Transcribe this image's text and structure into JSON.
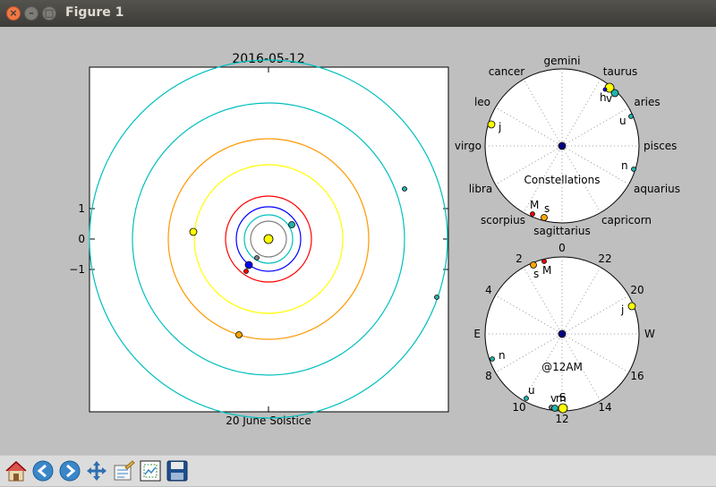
{
  "window": {
    "title": "Figure 1"
  },
  "toolbar": {
    "buttons": [
      {
        "name": "home-button",
        "icon": "home-icon"
      },
      {
        "name": "back-button",
        "icon": "back-arrow-icon"
      },
      {
        "name": "forward-button",
        "icon": "forward-arrow-icon"
      },
      {
        "name": "pan-button",
        "icon": "move-icon"
      },
      {
        "name": "configure-subplots-button",
        "icon": "edit-icon"
      },
      {
        "name": "zoom-to-rect-button",
        "icon": "zoom-rect-icon"
      },
      {
        "name": "save-button",
        "icon": "floppy-disk-icon"
      }
    ]
  },
  "orbit_plot": {
    "title": "2016-05-12",
    "xlabel": "20 June Solstice",
    "yticks": [
      "1",
      "0",
      "−1"
    ]
  },
  "constellation_plot": {
    "center_label": "Constellations",
    "labels": [
      "gemini",
      "taurus",
      "aries",
      "pisces",
      "aquarius",
      "capricorn",
      "sagittarius",
      "scorpius",
      "libra",
      "virgo",
      "leo",
      "cancer"
    ],
    "planet_labels": [
      "h",
      "v",
      "u",
      "n",
      "j",
      "M",
      "s"
    ]
  },
  "clock_plot": {
    "center_label": "@12AM",
    "labels": [
      "0",
      "22",
      "20",
      "W",
      "16",
      "14",
      "12",
      "10",
      "8",
      "E",
      "4",
      "2"
    ],
    "planet_labels": [
      "j",
      "M",
      "s",
      "n",
      "u",
      "v",
      "m",
      "S"
    ]
  },
  "colors": {
    "sun": "#ffff00",
    "mercury": "#808080",
    "venus": "#20b2aa",
    "earth": "#0000ff",
    "mars": "#ff0000",
    "jupiter": "#ffff00",
    "saturn": "#ffa500",
    "uranus": "#20b2aa",
    "neptune": "#20b2aa"
  }
}
